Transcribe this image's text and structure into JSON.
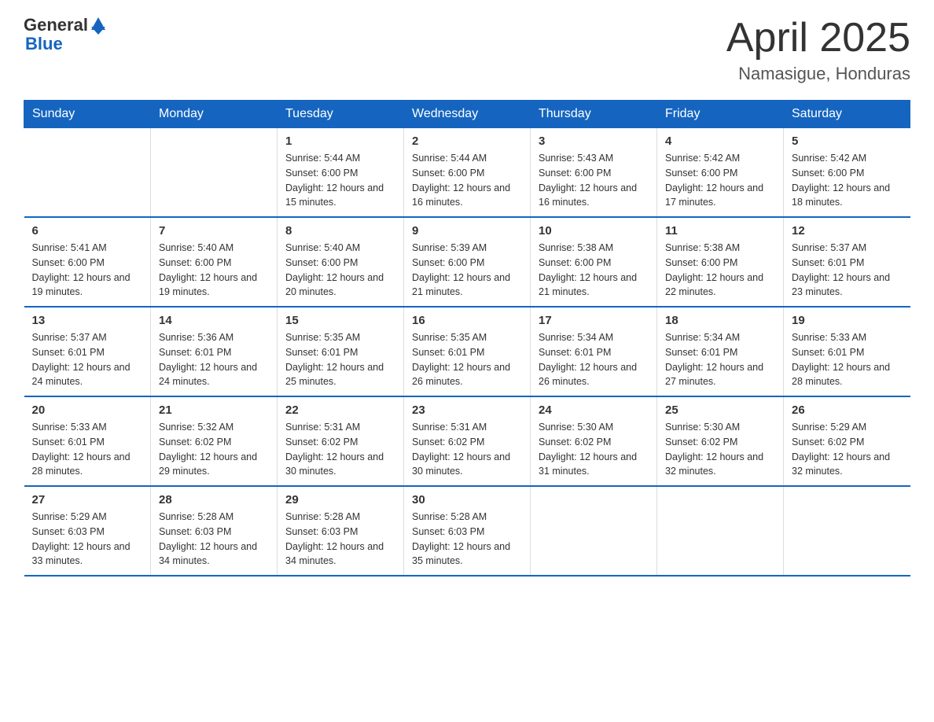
{
  "header": {
    "logo_general": "General",
    "logo_blue": "Blue",
    "month_year": "April 2025",
    "location": "Namasigue, Honduras"
  },
  "days_of_week": [
    "Sunday",
    "Monday",
    "Tuesday",
    "Wednesday",
    "Thursday",
    "Friday",
    "Saturday"
  ],
  "weeks": [
    [
      {
        "day": "",
        "sunrise": "",
        "sunset": "",
        "daylight": ""
      },
      {
        "day": "",
        "sunrise": "",
        "sunset": "",
        "daylight": ""
      },
      {
        "day": "1",
        "sunrise": "Sunrise: 5:44 AM",
        "sunset": "Sunset: 6:00 PM",
        "daylight": "Daylight: 12 hours and 15 minutes."
      },
      {
        "day": "2",
        "sunrise": "Sunrise: 5:44 AM",
        "sunset": "Sunset: 6:00 PM",
        "daylight": "Daylight: 12 hours and 16 minutes."
      },
      {
        "day": "3",
        "sunrise": "Sunrise: 5:43 AM",
        "sunset": "Sunset: 6:00 PM",
        "daylight": "Daylight: 12 hours and 16 minutes."
      },
      {
        "day": "4",
        "sunrise": "Sunrise: 5:42 AM",
        "sunset": "Sunset: 6:00 PM",
        "daylight": "Daylight: 12 hours and 17 minutes."
      },
      {
        "day": "5",
        "sunrise": "Sunrise: 5:42 AM",
        "sunset": "Sunset: 6:00 PM",
        "daylight": "Daylight: 12 hours and 18 minutes."
      }
    ],
    [
      {
        "day": "6",
        "sunrise": "Sunrise: 5:41 AM",
        "sunset": "Sunset: 6:00 PM",
        "daylight": "Daylight: 12 hours and 19 minutes."
      },
      {
        "day": "7",
        "sunrise": "Sunrise: 5:40 AM",
        "sunset": "Sunset: 6:00 PM",
        "daylight": "Daylight: 12 hours and 19 minutes."
      },
      {
        "day": "8",
        "sunrise": "Sunrise: 5:40 AM",
        "sunset": "Sunset: 6:00 PM",
        "daylight": "Daylight: 12 hours and 20 minutes."
      },
      {
        "day": "9",
        "sunrise": "Sunrise: 5:39 AM",
        "sunset": "Sunset: 6:00 PM",
        "daylight": "Daylight: 12 hours and 21 minutes."
      },
      {
        "day": "10",
        "sunrise": "Sunrise: 5:38 AM",
        "sunset": "Sunset: 6:00 PM",
        "daylight": "Daylight: 12 hours and 21 minutes."
      },
      {
        "day": "11",
        "sunrise": "Sunrise: 5:38 AM",
        "sunset": "Sunset: 6:00 PM",
        "daylight": "Daylight: 12 hours and 22 minutes."
      },
      {
        "day": "12",
        "sunrise": "Sunrise: 5:37 AM",
        "sunset": "Sunset: 6:01 PM",
        "daylight": "Daylight: 12 hours and 23 minutes."
      }
    ],
    [
      {
        "day": "13",
        "sunrise": "Sunrise: 5:37 AM",
        "sunset": "Sunset: 6:01 PM",
        "daylight": "Daylight: 12 hours and 24 minutes."
      },
      {
        "day": "14",
        "sunrise": "Sunrise: 5:36 AM",
        "sunset": "Sunset: 6:01 PM",
        "daylight": "Daylight: 12 hours and 24 minutes."
      },
      {
        "day": "15",
        "sunrise": "Sunrise: 5:35 AM",
        "sunset": "Sunset: 6:01 PM",
        "daylight": "Daylight: 12 hours and 25 minutes."
      },
      {
        "day": "16",
        "sunrise": "Sunrise: 5:35 AM",
        "sunset": "Sunset: 6:01 PM",
        "daylight": "Daylight: 12 hours and 26 minutes."
      },
      {
        "day": "17",
        "sunrise": "Sunrise: 5:34 AM",
        "sunset": "Sunset: 6:01 PM",
        "daylight": "Daylight: 12 hours and 26 minutes."
      },
      {
        "day": "18",
        "sunrise": "Sunrise: 5:34 AM",
        "sunset": "Sunset: 6:01 PM",
        "daylight": "Daylight: 12 hours and 27 minutes."
      },
      {
        "day": "19",
        "sunrise": "Sunrise: 5:33 AM",
        "sunset": "Sunset: 6:01 PM",
        "daylight": "Daylight: 12 hours and 28 minutes."
      }
    ],
    [
      {
        "day": "20",
        "sunrise": "Sunrise: 5:33 AM",
        "sunset": "Sunset: 6:01 PM",
        "daylight": "Daylight: 12 hours and 28 minutes."
      },
      {
        "day": "21",
        "sunrise": "Sunrise: 5:32 AM",
        "sunset": "Sunset: 6:02 PM",
        "daylight": "Daylight: 12 hours and 29 minutes."
      },
      {
        "day": "22",
        "sunrise": "Sunrise: 5:31 AM",
        "sunset": "Sunset: 6:02 PM",
        "daylight": "Daylight: 12 hours and 30 minutes."
      },
      {
        "day": "23",
        "sunrise": "Sunrise: 5:31 AM",
        "sunset": "Sunset: 6:02 PM",
        "daylight": "Daylight: 12 hours and 30 minutes."
      },
      {
        "day": "24",
        "sunrise": "Sunrise: 5:30 AM",
        "sunset": "Sunset: 6:02 PM",
        "daylight": "Daylight: 12 hours and 31 minutes."
      },
      {
        "day": "25",
        "sunrise": "Sunrise: 5:30 AM",
        "sunset": "Sunset: 6:02 PM",
        "daylight": "Daylight: 12 hours and 32 minutes."
      },
      {
        "day": "26",
        "sunrise": "Sunrise: 5:29 AM",
        "sunset": "Sunset: 6:02 PM",
        "daylight": "Daylight: 12 hours and 32 minutes."
      }
    ],
    [
      {
        "day": "27",
        "sunrise": "Sunrise: 5:29 AM",
        "sunset": "Sunset: 6:03 PM",
        "daylight": "Daylight: 12 hours and 33 minutes."
      },
      {
        "day": "28",
        "sunrise": "Sunrise: 5:28 AM",
        "sunset": "Sunset: 6:03 PM",
        "daylight": "Daylight: 12 hours and 34 minutes."
      },
      {
        "day": "29",
        "sunrise": "Sunrise: 5:28 AM",
        "sunset": "Sunset: 6:03 PM",
        "daylight": "Daylight: 12 hours and 34 minutes."
      },
      {
        "day": "30",
        "sunrise": "Sunrise: 5:28 AM",
        "sunset": "Sunset: 6:03 PM",
        "daylight": "Daylight: 12 hours and 35 minutes."
      },
      {
        "day": "",
        "sunrise": "",
        "sunset": "",
        "daylight": ""
      },
      {
        "day": "",
        "sunrise": "",
        "sunset": "",
        "daylight": ""
      },
      {
        "day": "",
        "sunrise": "",
        "sunset": "",
        "daylight": ""
      }
    ]
  ]
}
